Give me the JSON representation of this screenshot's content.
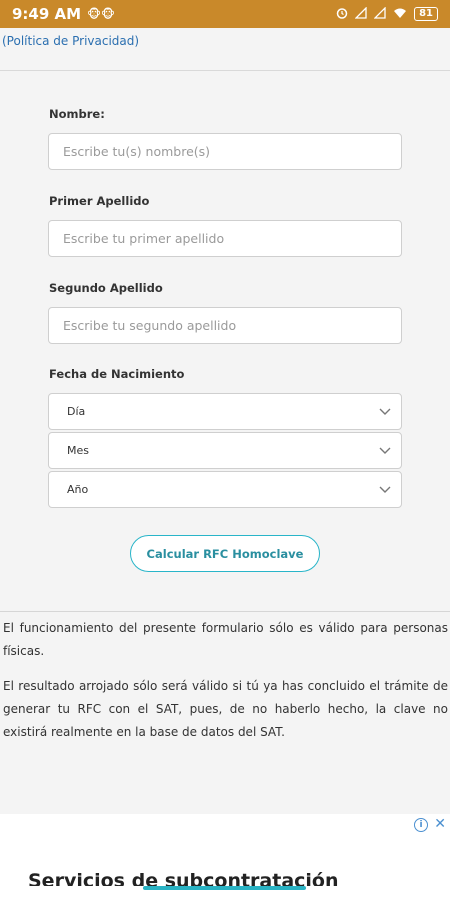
{
  "status_bar": {
    "time": "9:49 AM",
    "notif_emojis": "🐵🐵",
    "battery": "81"
  },
  "privacy": {
    "link_text": "(Política de Privacidad)"
  },
  "form": {
    "nombre": {
      "label": "Nombre:",
      "placeholder": "Escribe tu(s) nombre(s)"
    },
    "primer_apellido": {
      "label": "Primer Apellido",
      "placeholder": "Escribe tu primer apellido"
    },
    "segundo_apellido": {
      "label": "Segundo Apellido",
      "placeholder": "Escribe tu segundo apellido"
    },
    "fecha": {
      "label": "Fecha de Nacimiento",
      "dia": "Día",
      "mes": "Mes",
      "anio": "Año"
    },
    "submit_label": "Calcular RFC Homoclave"
  },
  "info": {
    "paragraph1": "El funcionamiento del presente formulario sólo es válido para personas físicas.",
    "paragraph2": "El resultado arrojado sólo será válido si tú ya has concluido el trámite de generar tu RFC con el SAT, pues, de no haberlo hecho, la clave no existirá realmente en la base de datos del SAT."
  },
  "ad": {
    "headline": "Servicios de subcontratación"
  },
  "colors": {
    "status_bar": "#c9892a",
    "accent": "#29b5c9",
    "link": "#2b6fb0"
  }
}
